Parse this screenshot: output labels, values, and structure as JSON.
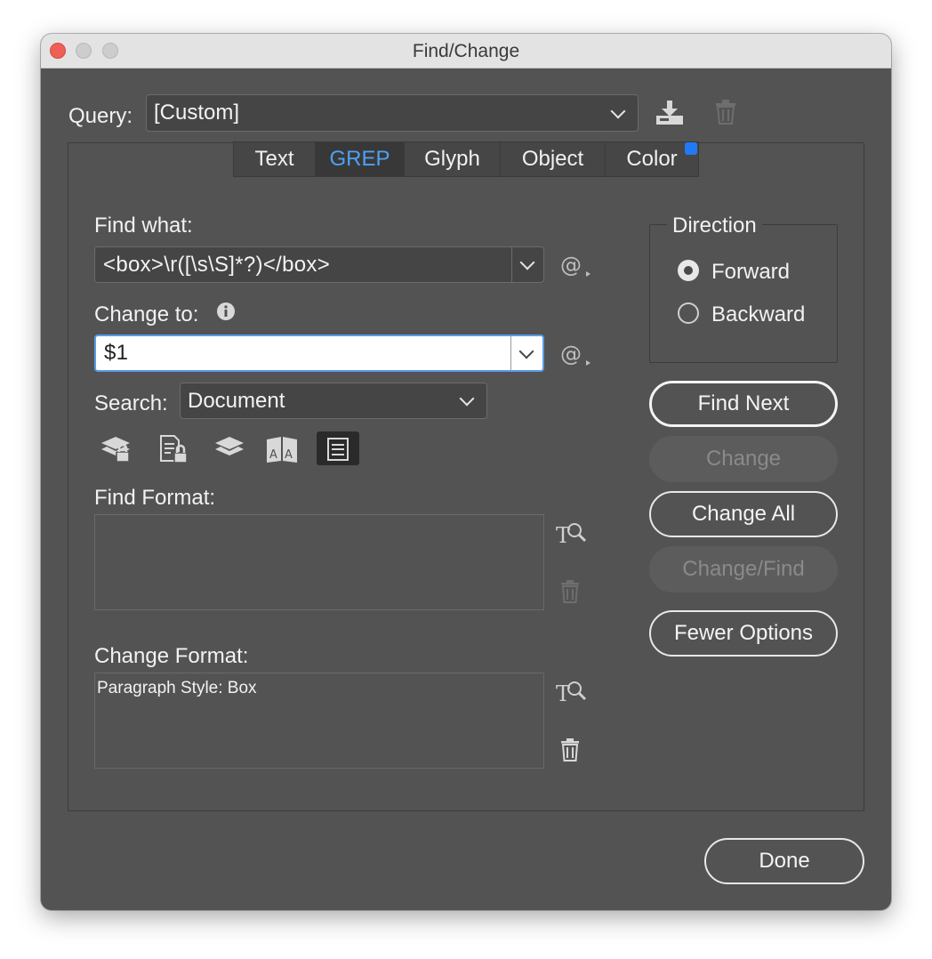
{
  "window": {
    "title": "Find/Change"
  },
  "query": {
    "label": "Query:",
    "value": "[Custom]"
  },
  "tabs": [
    {
      "label": "Text",
      "active": false
    },
    {
      "label": "GREP",
      "active": true
    },
    {
      "label": "Glyph",
      "active": false
    },
    {
      "label": "Object",
      "active": false
    },
    {
      "label": "Color",
      "active": false
    }
  ],
  "find_what": {
    "label": "Find what:",
    "value": "<box>\\r([\\s\\S]*?)</box>"
  },
  "change_to": {
    "label": "Change to:",
    "value": "$1"
  },
  "search": {
    "label": "Search:",
    "value": "Document"
  },
  "search_options_icons": [
    "include-locked-layers-icon",
    "include-locked-stories-icon",
    "include-hidden-layers-icon",
    "include-master-pages-icon",
    "include-footnotes-icon"
  ],
  "find_format": {
    "label": "Find Format:",
    "content": ""
  },
  "change_format": {
    "label": "Change Format:",
    "content": "Paragraph Style: Box"
  },
  "direction": {
    "label": "Direction",
    "options": [
      {
        "label": "Forward",
        "selected": true
      },
      {
        "label": "Backward",
        "selected": false
      }
    ]
  },
  "buttons": {
    "find_next": "Find Next",
    "change": "Change",
    "change_all": "Change All",
    "change_find": "Change/Find",
    "fewer_options": "Fewer Options",
    "done": "Done"
  },
  "colors": {
    "accent": "#4ea1f3",
    "dialog_bg": "#535353",
    "badge": "#1f7af5"
  }
}
